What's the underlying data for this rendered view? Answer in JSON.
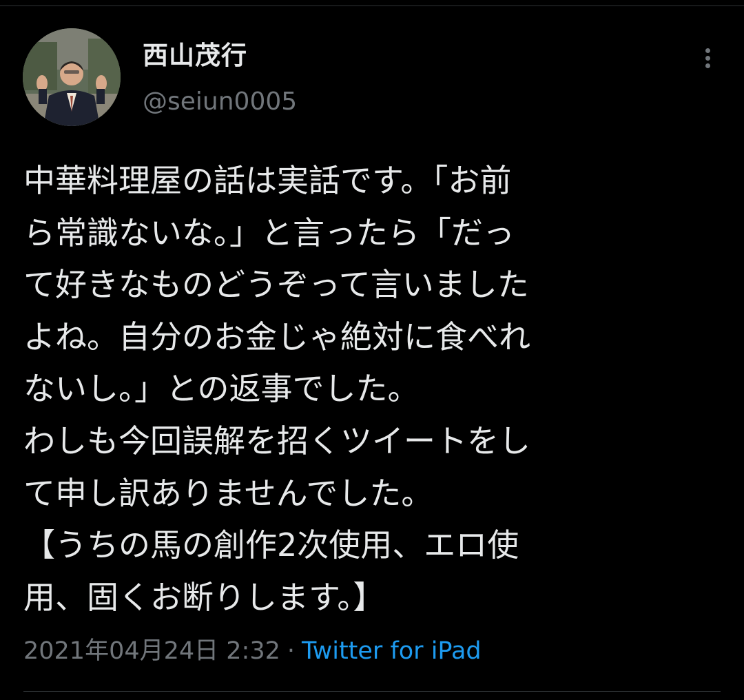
{
  "tweet": {
    "author": {
      "display_name": "西山茂行",
      "handle": "@seiun0005"
    },
    "text_lines": [
      "中華料理屋の話は実話です。「お前",
      "ら常識ないな。」と言ったら「だっ",
      "て好きなものどうぞって言いました",
      "よね。自分のお金じゃ絶対に食べれ",
      "ないし。」との返事でした。",
      "わしも今回誤解を招くツイートをし",
      "て申し訳ありませんでした。",
      "【うちの馬の創作2次使用、エロ使",
      "用、固くお断りします。】"
    ],
    "timestamp": "2021年04月24日 2:32",
    "separator": "·",
    "source": "Twitter for iPad"
  },
  "icons": {
    "more": "more-vertical-icon"
  },
  "colors": {
    "background": "#000000",
    "text": "#e7e9ea",
    "secondary": "#71767b",
    "link": "#1d9bf0",
    "divider": "#2f3336"
  }
}
